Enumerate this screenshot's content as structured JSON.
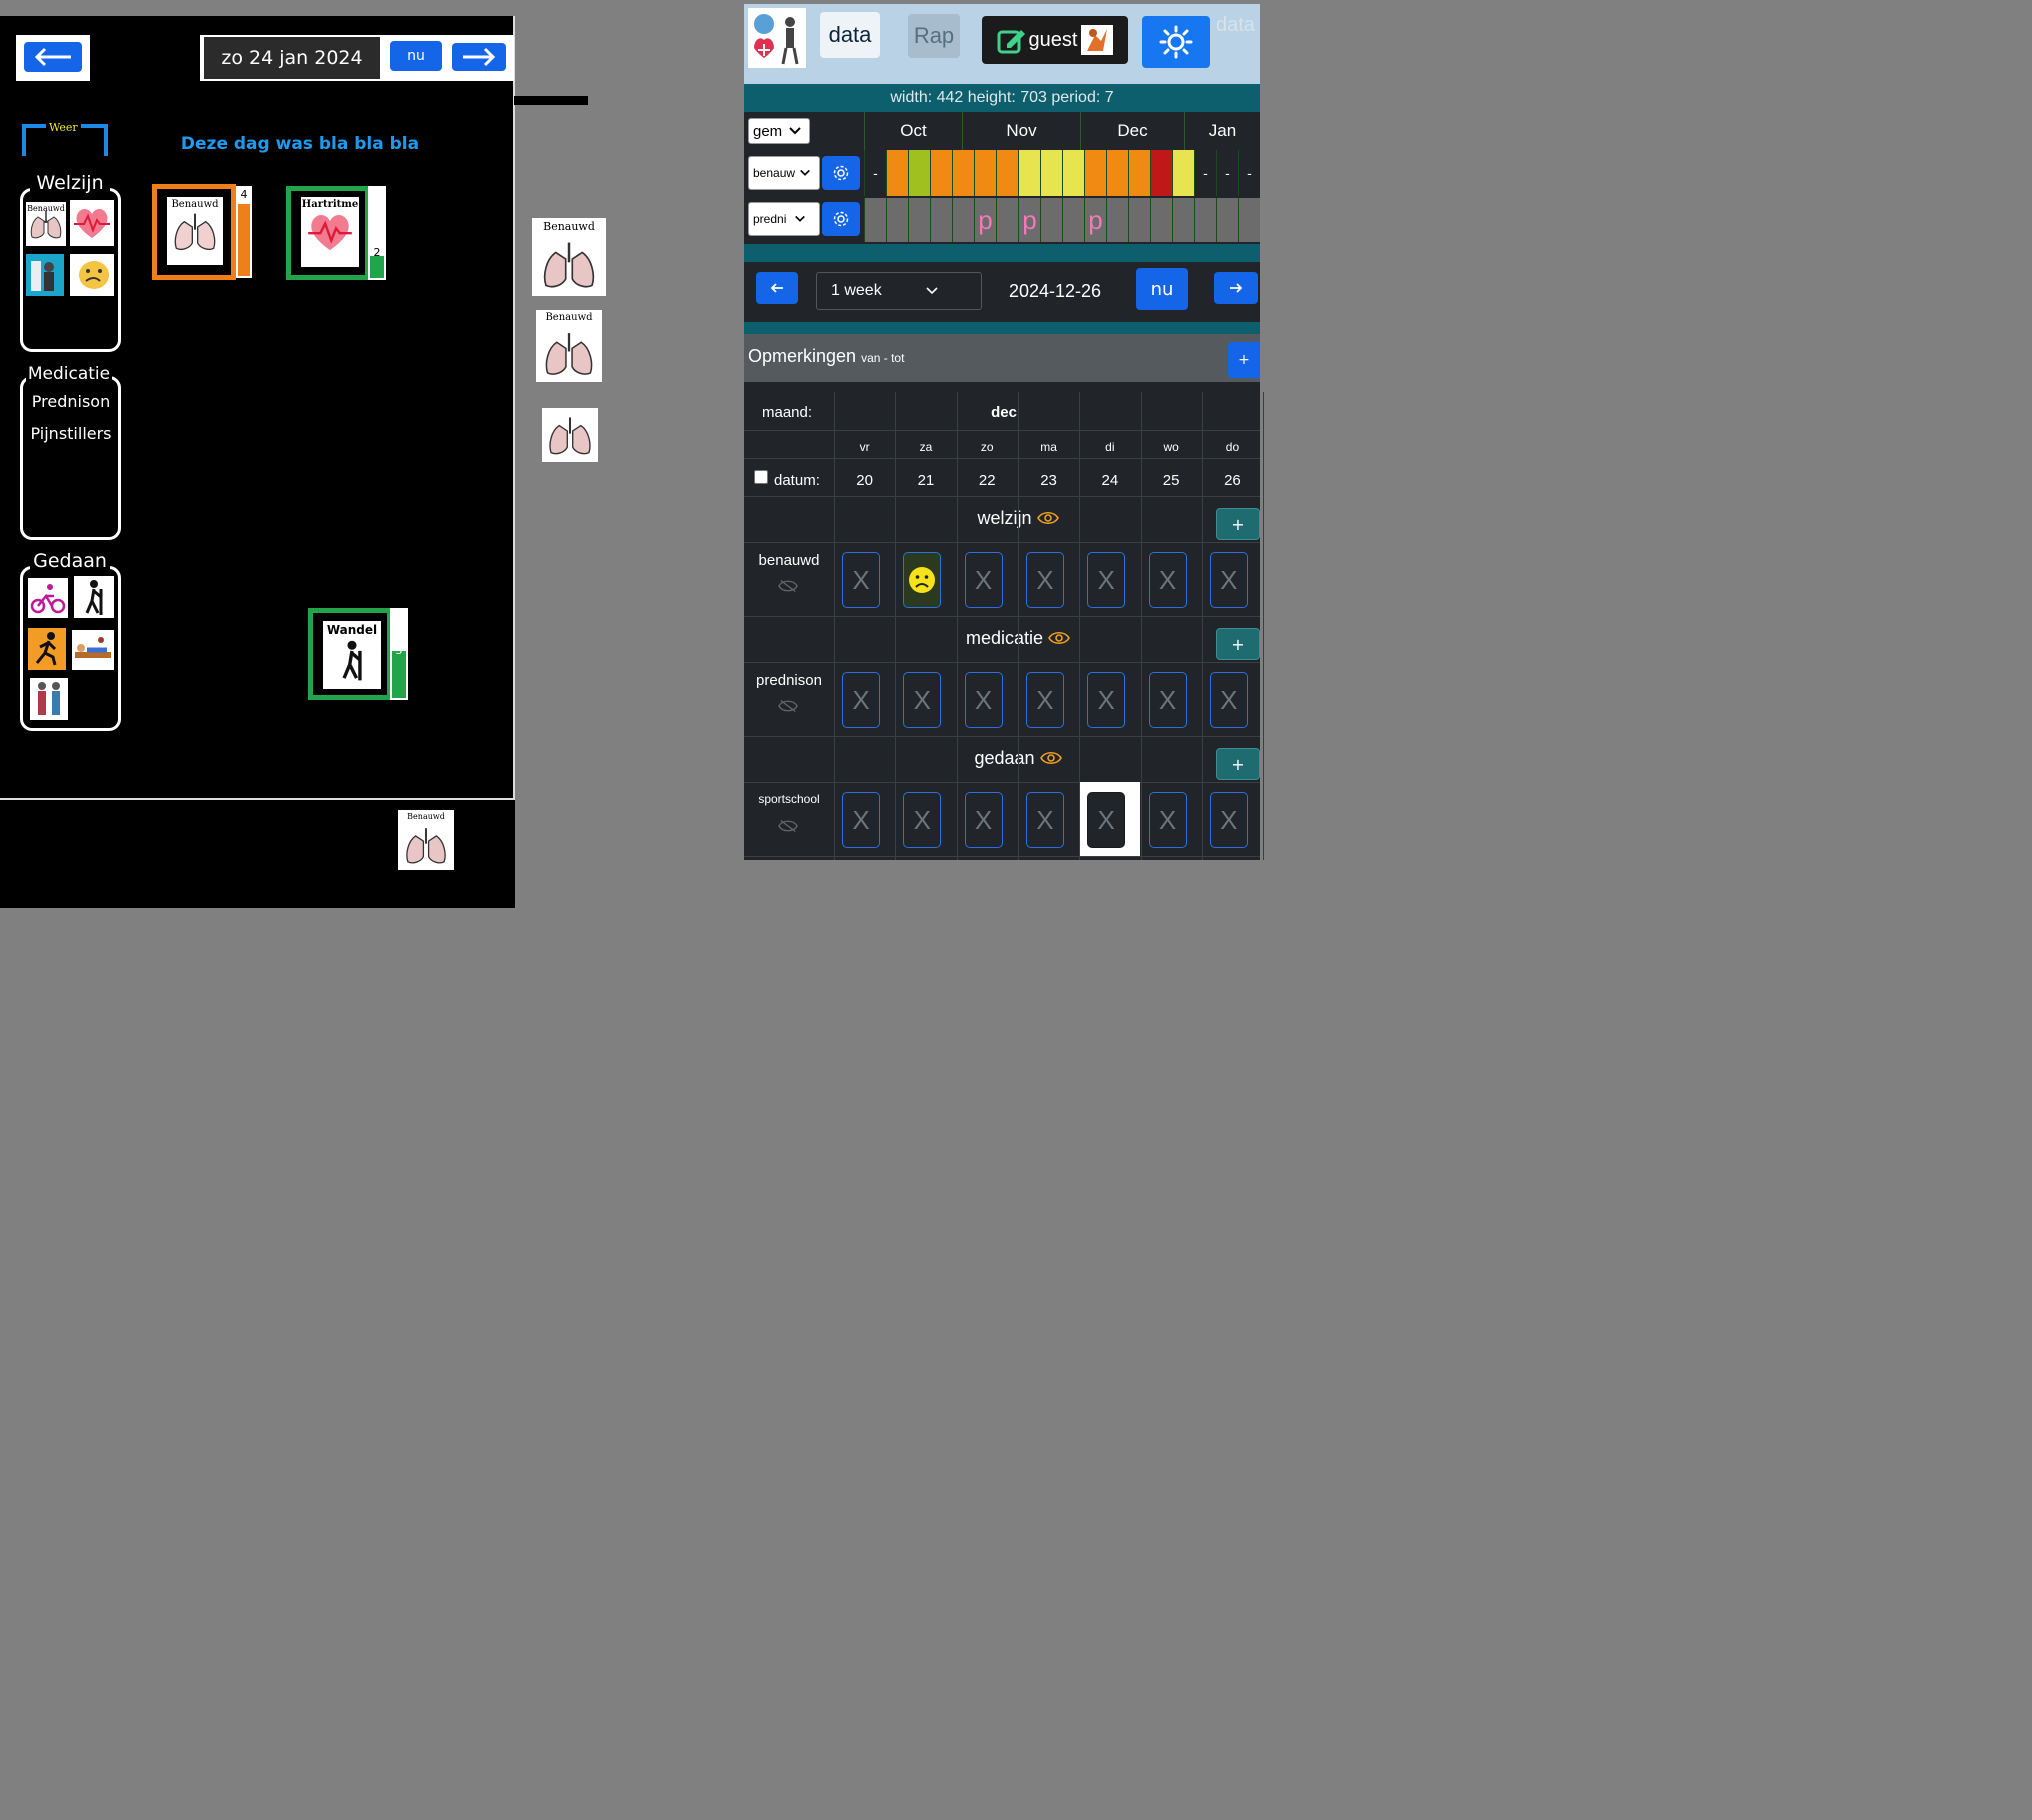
{
  "left": {
    "date_text": "zo 24 jan 2024",
    "nu_label": "nu",
    "weer_label": "Weer",
    "day_note": "Deze dag was bla bla bla",
    "categories": {
      "welzijn": "Welzijn",
      "medicatie": "Medicatie",
      "gedaan": "Gedaan"
    },
    "medicatie_items": [
      "Prednison",
      "Pijnstillers"
    ],
    "welzijn_icons": [
      "lungs-icon",
      "heart-icon",
      "shower-icon",
      "face-icon"
    ],
    "welzijn_small_label": "Benauwd",
    "gedaan_icons": [
      "bike-icon",
      "hiking-icon",
      "running-icon",
      "massage-icon",
      "people-icon"
    ],
    "cards": [
      {
        "label": "Benauwd",
        "count": "4",
        "border": "#f07f1a",
        "fill_color": "#f07f1a",
        "level_fraction": 1.0
      },
      {
        "label": "Hartritme",
        "count": "2",
        "border": "#22a44a",
        "fill_color": "#22a44a",
        "level_fraction": 0.3
      },
      {
        "label": "Wandel",
        "count": "3",
        "border": "#22a44a",
        "fill_color": "#22a44a",
        "level_fraction": 0.65
      }
    ],
    "floating_label": "Benauwd"
  },
  "right": {
    "tabs": {
      "data": "data",
      "rap": "Rap",
      "guest": "guest",
      "ghost": "data"
    },
    "info": "width: 442 height: 703 period: 7",
    "overview": {
      "agg_select": "gem",
      "months": [
        "Oct",
        "Nov",
        "Dec",
        "Jan"
      ],
      "rows": [
        {
          "select": "benauw",
          "cells": [
            {
              "t": "-",
              "c": "#212529"
            },
            {
              "t": "",
              "c": "#f08a12"
            },
            {
              "t": "",
              "c": "#a0c020"
            },
            {
              "t": "",
              "c": "#f08a12"
            },
            {
              "t": "",
              "c": "#f08a12"
            },
            {
              "t": "",
              "c": "#f08a12"
            },
            {
              "t": "",
              "c": "#f08a12"
            },
            {
              "t": "",
              "c": "#e8e44f"
            },
            {
              "t": "",
              "c": "#e8e44f"
            },
            {
              "t": "",
              "c": "#e8e44f"
            },
            {
              "t": "",
              "c": "#f08a12"
            },
            {
              "t": "",
              "c": "#f08a12"
            },
            {
              "t": "",
              "c": "#f08a12"
            },
            {
              "t": "",
              "c": "#c01818"
            },
            {
              "t": "",
              "c": "#e8e44f"
            },
            {
              "t": "-",
              "c": "#212529"
            },
            {
              "t": "-",
              "c": "#212529"
            },
            {
              "t": "-",
              "c": "#212529"
            }
          ]
        },
        {
          "select": "predni",
          "cells": [
            {
              "t": "",
              "c": "#6c6c6c"
            },
            {
              "t": "",
              "c": "#6c6c6c"
            },
            {
              "t": "",
              "c": "#6c6c6c"
            },
            {
              "t": "",
              "c": "#6c6c6c"
            },
            {
              "t": "",
              "c": "#6c6c6c"
            },
            {
              "t": "p",
              "c": "#6c6c6c"
            },
            {
              "t": "",
              "c": "#6c6c6c"
            },
            {
              "t": "p",
              "c": "#6c6c6c"
            },
            {
              "t": "",
              "c": "#6c6c6c"
            },
            {
              "t": "",
              "c": "#6c6c6c"
            },
            {
              "t": "p",
              "c": "#6c6c6c"
            },
            {
              "t": "",
              "c": "#6c6c6c"
            },
            {
              "t": "",
              "c": "#6c6c6c"
            },
            {
              "t": "",
              "c": "#6c6c6c"
            },
            {
              "t": "",
              "c": "#6c6c6c"
            },
            {
              "t": "",
              "c": "#6c6c6c"
            },
            {
              "t": "",
              "c": "#6c6c6c"
            },
            {
              "t": "",
              "c": "#6c6c6c"
            }
          ]
        }
      ]
    },
    "nav": {
      "period": "1 week",
      "date": "2024-12-26",
      "nu": "nu"
    },
    "opmerkingen": {
      "title": "Opmerkingen",
      "sub": "van - tot",
      "plus": "+"
    },
    "table": {
      "maand_label": "maand:",
      "month": "dec",
      "weekdays": [
        "vr",
        "za",
        "zo",
        "ma",
        "di",
        "wo",
        "do"
      ],
      "datum_label": "datum:",
      "dates": [
        "20",
        "21",
        "22",
        "23",
        "24",
        "25",
        "26"
      ],
      "x_mark": "X",
      "sections": [
        {
          "title": "welzijn",
          "row_label": "benauwd",
          "marks": [
            "X",
            "sad",
            "X",
            "X",
            "X",
            "X",
            "X"
          ]
        },
        {
          "title": "medicatie",
          "row_label": "prednison",
          "marks": [
            "X",
            "X",
            "X",
            "X",
            "X",
            "X",
            "X"
          ]
        },
        {
          "title": "gedaan",
          "row_label": "sportschool",
          "marks": [
            "X",
            "X",
            "X",
            "X",
            "X-selected",
            "X",
            "X"
          ]
        }
      ],
      "plus": "+"
    }
  }
}
